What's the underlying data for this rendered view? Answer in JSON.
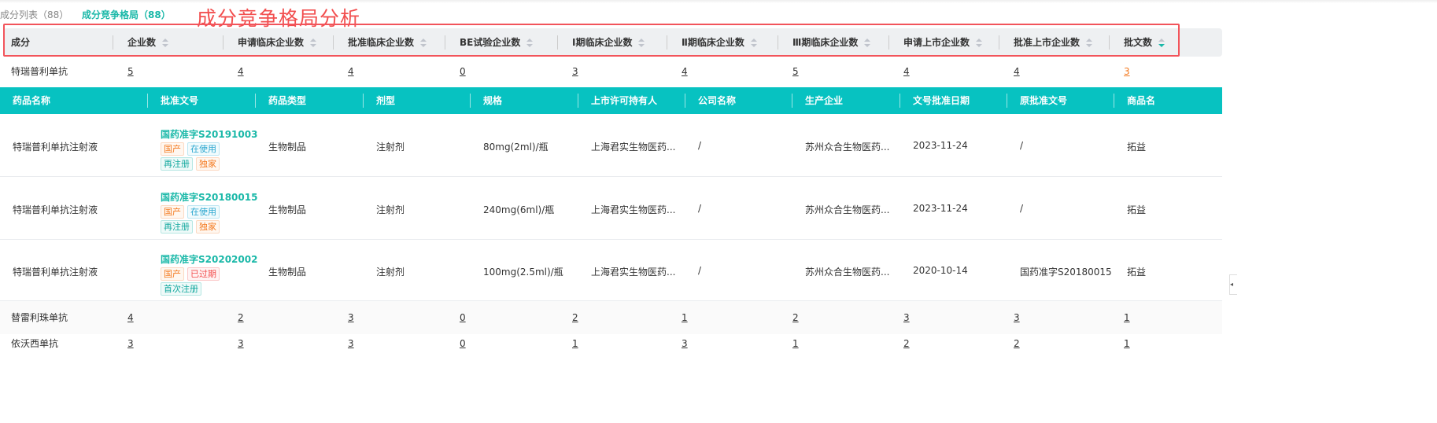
{
  "tabs": [
    {
      "label": "成分列表（88）"
    },
    {
      "label": "成分竞争格局（88）"
    }
  ],
  "annotation": "成分竞争格局分析",
  "summary_headers": [
    "成分",
    "企业数",
    "申请临床企业数",
    "批准临床企业数",
    "BE试验企业数",
    "Ⅰ期临床企业数",
    "Ⅱ期临床企业数",
    "Ⅲ期临床企业数",
    "申请上市企业数",
    "批准上市企业数",
    "批文数"
  ],
  "summary_rows": [
    {
      "name": "特瑞普利单抗",
      "values": [
        "5",
        "4",
        "4",
        "0",
        "3",
        "4",
        "5",
        "4",
        "4",
        "3"
      ]
    },
    {
      "name": "替雷利珠单抗",
      "values": [
        "4",
        "2",
        "3",
        "0",
        "2",
        "1",
        "2",
        "3",
        "3",
        "1"
      ]
    },
    {
      "name": "依沃西单抗",
      "values": [
        "3",
        "3",
        "3",
        "0",
        "1",
        "3",
        "1",
        "2",
        "2",
        "1"
      ]
    }
  ],
  "detail_headers": [
    "药品名称",
    "批准文号",
    "药品类型",
    "剂型",
    "规格",
    "上市许可持有人",
    "公司名称",
    "生产企业",
    "文号批准日期",
    "原批准文号",
    "商品名"
  ],
  "detail_rows": [
    {
      "name": "特瑞普利单抗注射液",
      "license": "国药准字S20191003",
      "tags": [
        [
          "国产",
          "o"
        ],
        [
          "在使用",
          "b"
        ],
        [
          "再注册",
          "g"
        ],
        [
          "独家",
          "o"
        ]
      ],
      "type": "生物制品",
      "form": "注射剂",
      "spec": "80mg(2ml)/瓶",
      "holder": "上海君实生物医药...",
      "company": "/",
      "manufacturer": "苏州众合生物医药...",
      "date": "2023-11-24",
      "orig": "/",
      "brand": "拓益"
    },
    {
      "name": "特瑞普利单抗注射液",
      "license": "国药准字S20180015",
      "tags": [
        [
          "国产",
          "o"
        ],
        [
          "在使用",
          "b"
        ],
        [
          "再注册",
          "g"
        ],
        [
          "独家",
          "o"
        ]
      ],
      "type": "生物制品",
      "form": "注射剂",
      "spec": "240mg(6ml)/瓶",
      "holder": "上海君实生物医药...",
      "company": "/",
      "manufacturer": "苏州众合生物医药...",
      "date": "2023-11-24",
      "orig": "/",
      "brand": "拓益"
    },
    {
      "name": "特瑞普利单抗注射液",
      "license": "国药准字S20202002",
      "tags": [
        [
          "国产",
          "o"
        ],
        [
          "已过期",
          "r"
        ],
        [
          "首次注册",
          "g"
        ]
      ],
      "type": "生物制品",
      "form": "注射剂",
      "spec": "100mg(2.5ml)/瓶",
      "holder": "上海君实生物医药...",
      "company": "/",
      "manufacturer": "苏州众合生物医药...",
      "date": "2020-10-14",
      "orig": "国药准字S20180015",
      "brand": "拓益"
    }
  ],
  "side_tab_icon": "◂"
}
